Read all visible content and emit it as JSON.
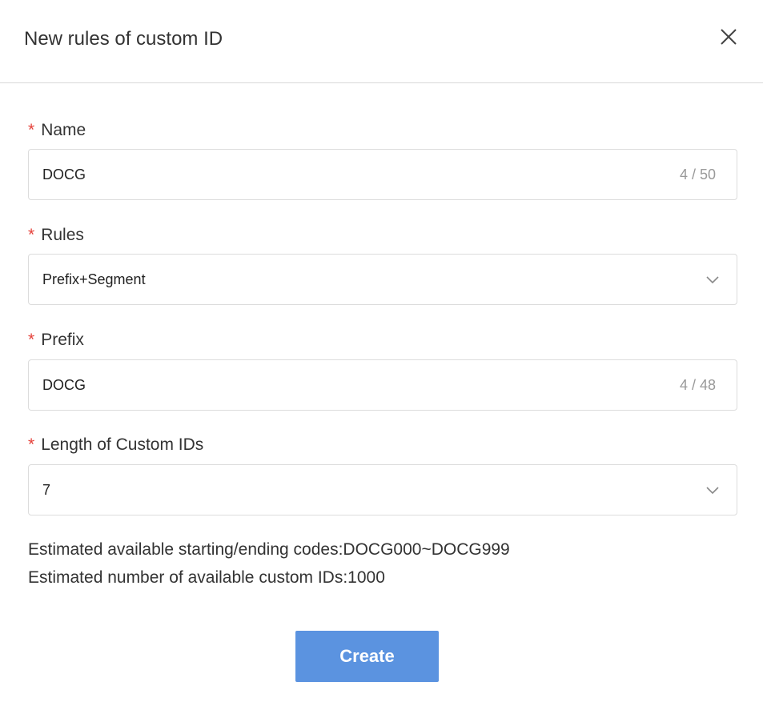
{
  "dialog": {
    "title": "New rules of custom ID",
    "close_icon": "close-icon"
  },
  "form": {
    "required_mark": "*",
    "name": {
      "label": "Name",
      "value": "DOCG",
      "counter": "4 / 50"
    },
    "rules": {
      "label": "Rules",
      "selected": "Prefix+Segment",
      "icon": "chevron-down-icon"
    },
    "prefix": {
      "label": "Prefix",
      "value": "DOCG",
      "counter": "4 / 48"
    },
    "length": {
      "label": "Length of Custom IDs",
      "selected": "7",
      "icon": "chevron-down-icon"
    }
  },
  "info": {
    "range_text": "Estimated available starting/ending codes:DOCG000~DOCG999",
    "count_text": "Estimated number of available custom IDs:1000"
  },
  "actions": {
    "create_label": "Create"
  },
  "colors": {
    "primary": "#5b93e0",
    "required": "#e5413a",
    "border": "#dcdcdc",
    "muted_text": "#999999"
  }
}
